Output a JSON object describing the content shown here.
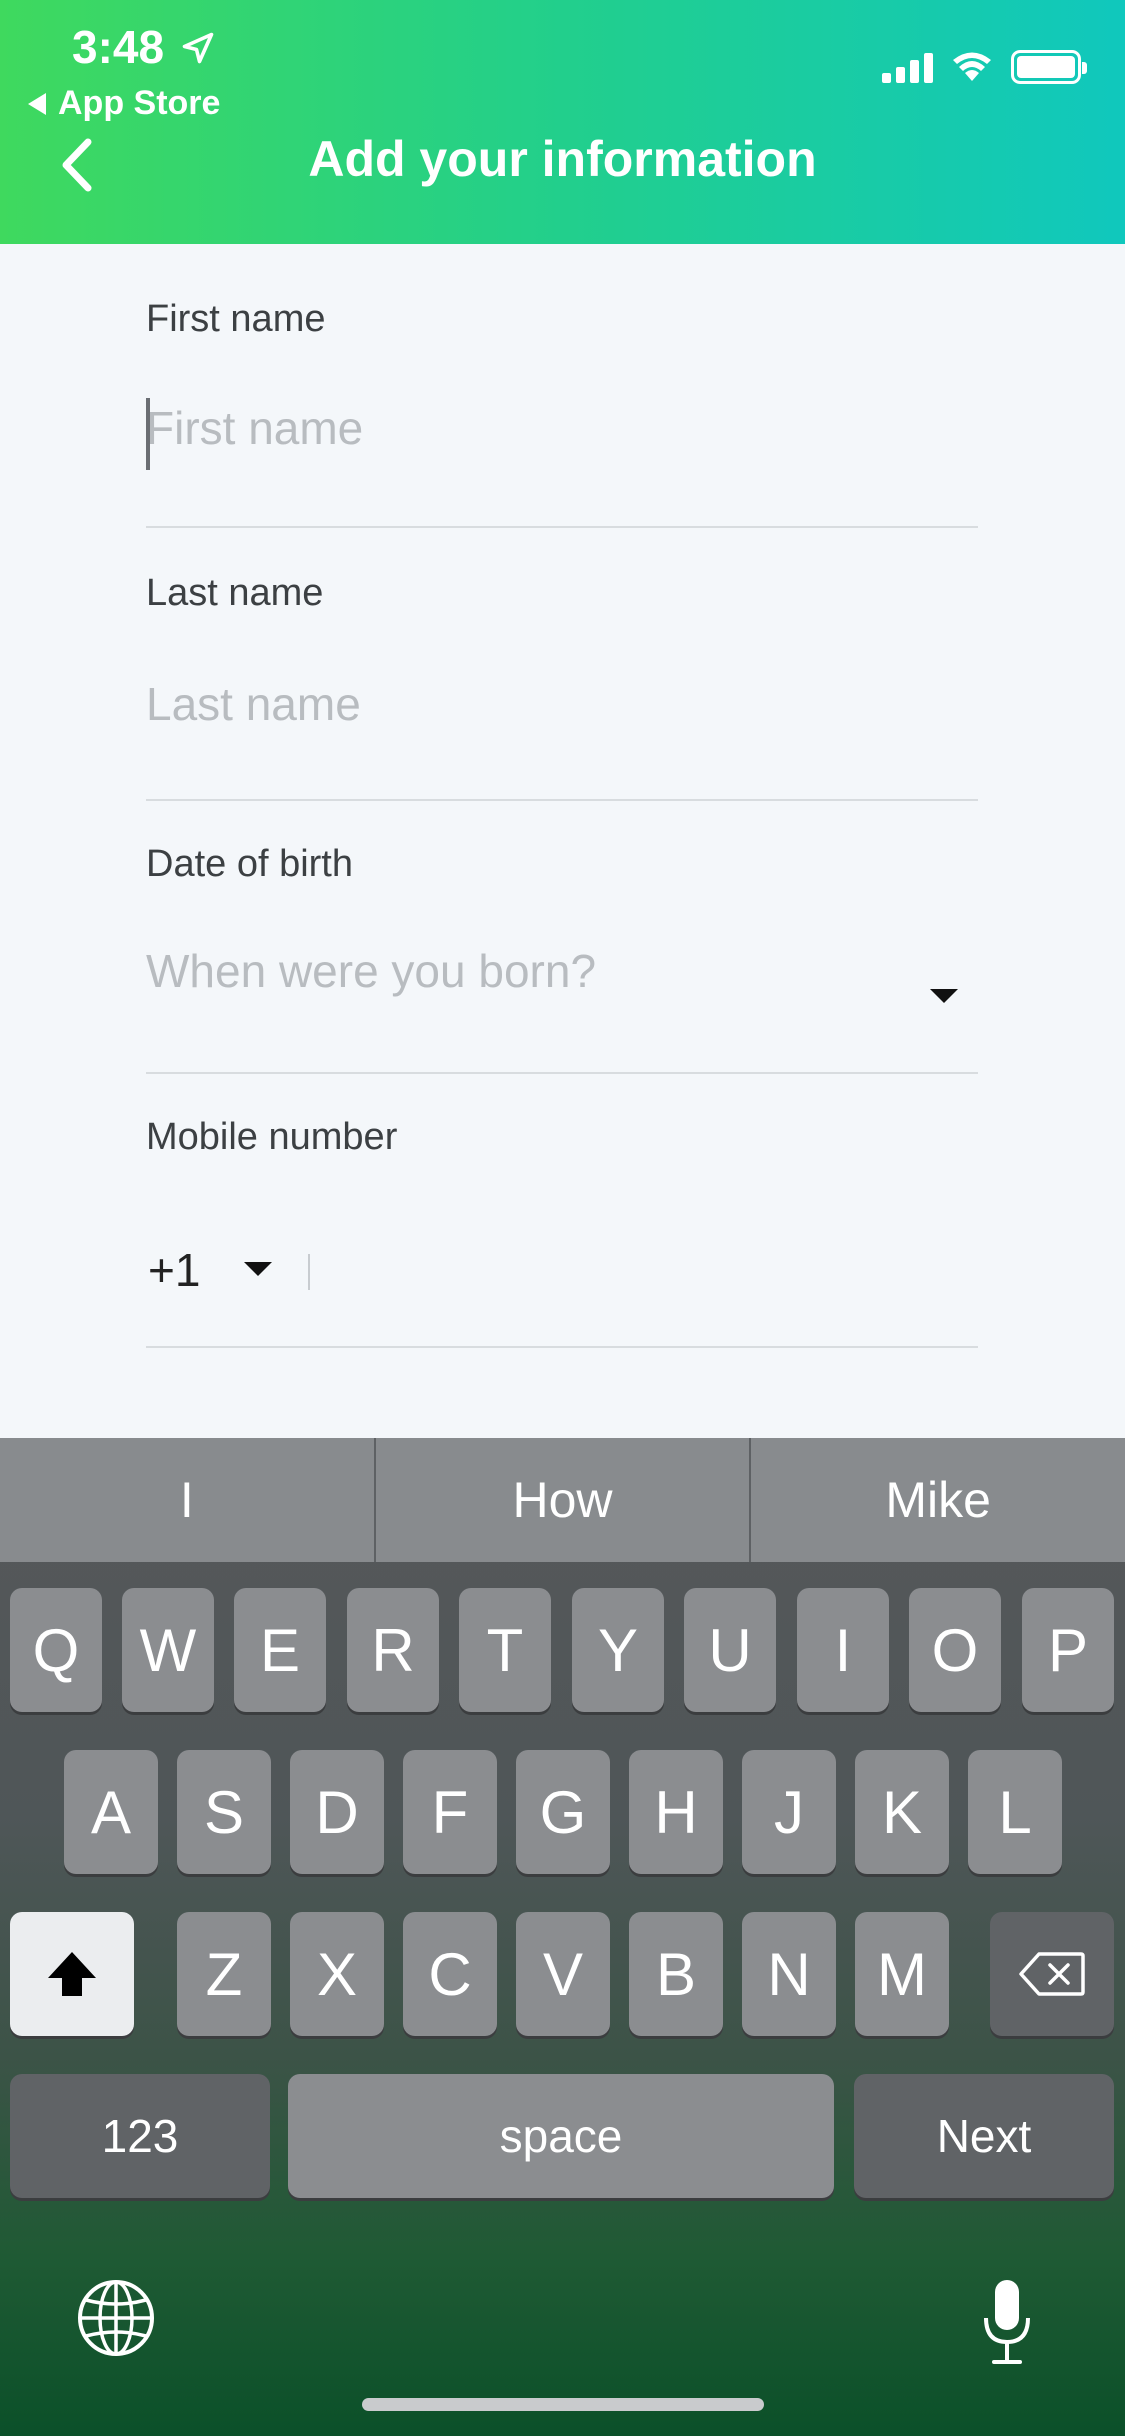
{
  "status_bar": {
    "time": "3:48",
    "back_app": "App Store"
  },
  "nav": {
    "title": "Add your information"
  },
  "form": {
    "first_name": {
      "label": "First name",
      "placeholder": "First name",
      "value": ""
    },
    "last_name": {
      "label": "Last name",
      "placeholder": "Last name",
      "value": ""
    },
    "dob": {
      "label": "Date of birth",
      "placeholder": "When were you born?"
    },
    "mobile": {
      "label": "Mobile number",
      "country_code": "+1",
      "value": ""
    }
  },
  "keyboard": {
    "suggestions": [
      "I",
      "How",
      "Mike"
    ],
    "row1": [
      "Q",
      "W",
      "E",
      "R",
      "T",
      "Y",
      "U",
      "I",
      "O",
      "P"
    ],
    "row2": [
      "A",
      "S",
      "D",
      "F",
      "G",
      "H",
      "J",
      "K",
      "L"
    ],
    "row3": [
      "Z",
      "X",
      "C",
      "V",
      "B",
      "N",
      "M"
    ],
    "numbers_label": "123",
    "space_label": "space",
    "next_label": "Next"
  },
  "colors": {
    "header_start": "#3fd95e",
    "header_end": "#10c8bd",
    "form_bg": "#f4f7fa"
  },
  "icons": [
    "location-arrow-icon",
    "signal-icon",
    "wifi-icon",
    "battery-icon",
    "back-chevron-icon",
    "dropdown-arrow-icon",
    "shift-icon",
    "delete-icon",
    "globe-icon",
    "microphone-icon"
  ]
}
